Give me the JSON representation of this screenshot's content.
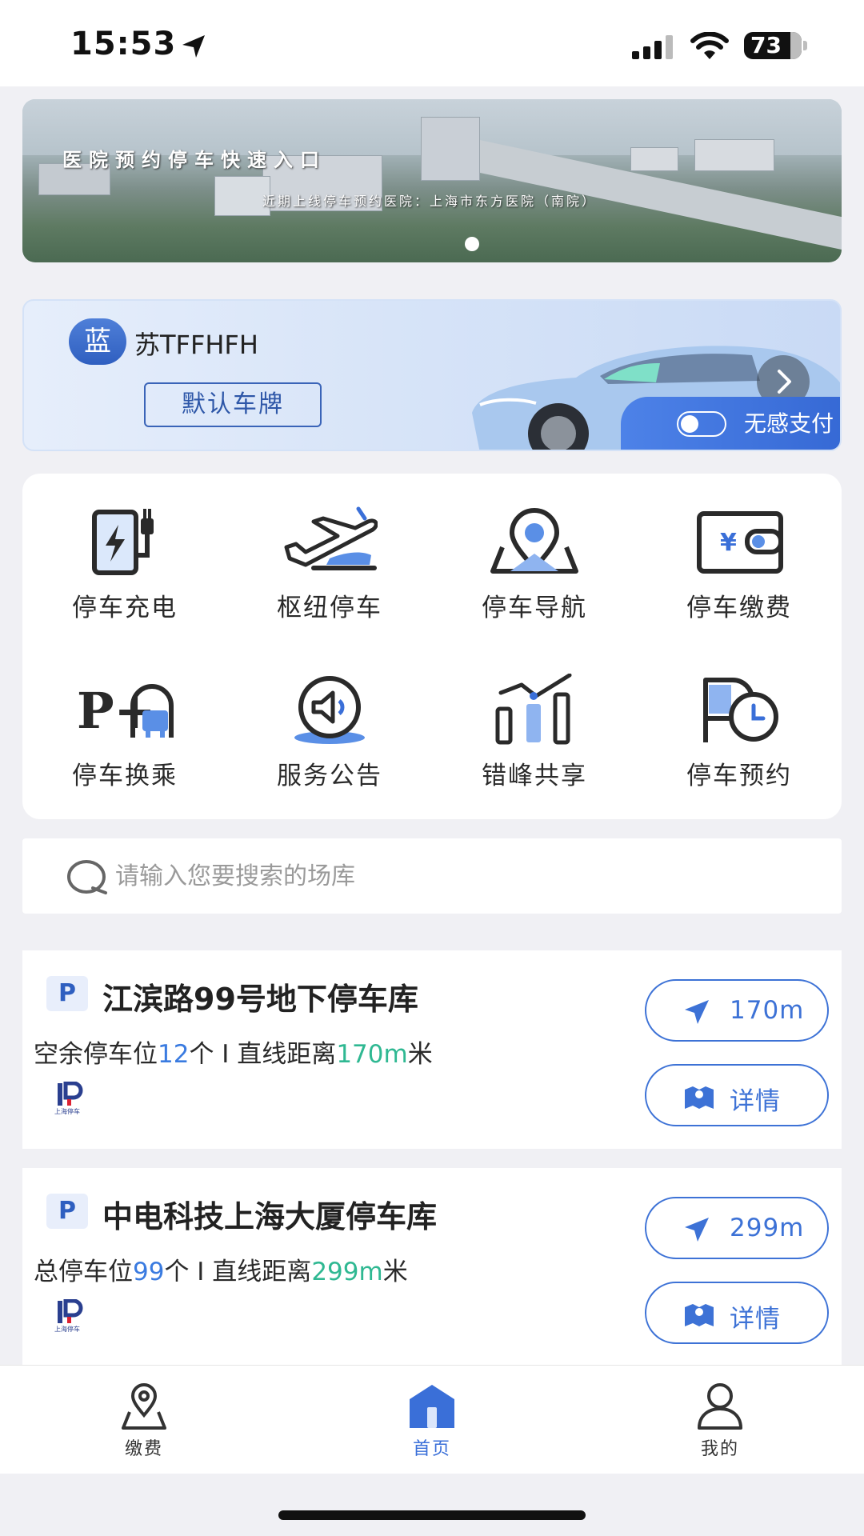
{
  "status_bar": {
    "time": "15:53",
    "battery": "73"
  },
  "banner": {
    "title": "医院预约停车快速入口",
    "subtitle": "近期上线停车预约医院：上海市东方医院（南院）"
  },
  "plate": {
    "badge": "蓝",
    "number": "苏TFFHFH",
    "default_label": "默认车牌",
    "no_pay_label": "无感支付"
  },
  "services": [
    {
      "label": "停车充电",
      "icon": "ev-charging-icon"
    },
    {
      "label": "枢纽停车",
      "icon": "airplane-icon"
    },
    {
      "label": "停车导航",
      "icon": "map-pin-icon"
    },
    {
      "label": "停车缴费",
      "icon": "wallet-yen-icon"
    },
    {
      "label": "停车换乘",
      "icon": "park-and-ride-icon"
    },
    {
      "label": "服务公告",
      "icon": "announcement-speaker-icon"
    },
    {
      "label": "错峰共享",
      "icon": "bar-trend-icon"
    },
    {
      "label": "停车预约",
      "icon": "parking-clock-icon"
    }
  ],
  "search": {
    "placeholder": "请输入您要搜索的场库"
  },
  "lots": [
    {
      "p": "P",
      "name": "江滨路99号地下停车库",
      "info_prefix": "空余停车位",
      "spaces": "12",
      "info_mid": "个 I 直线距离",
      "distance": "170m",
      "info_suffix": "米",
      "logo_text": "上海停车",
      "nav_label": "170m",
      "detail_label": "详情"
    },
    {
      "p": "P",
      "name": "中电科技上海大厦停车库",
      "info_prefix": "总停车位",
      "spaces": "99",
      "info_mid": "个 I 直线距离",
      "distance": "299m",
      "info_suffix": "米",
      "logo_text": "上海停车",
      "nav_label": "299m",
      "detail_label": "详情"
    }
  ],
  "tabbar": [
    {
      "label": "缴费",
      "icon": "location-person-icon"
    },
    {
      "label": "首页",
      "icon": "home-icon",
      "active": true
    },
    {
      "label": "我的",
      "icon": "user-icon"
    }
  ],
  "colors": {
    "accent": "#3a6fd8",
    "green": "#2fb892",
    "blue_value": "#3a7be0"
  }
}
